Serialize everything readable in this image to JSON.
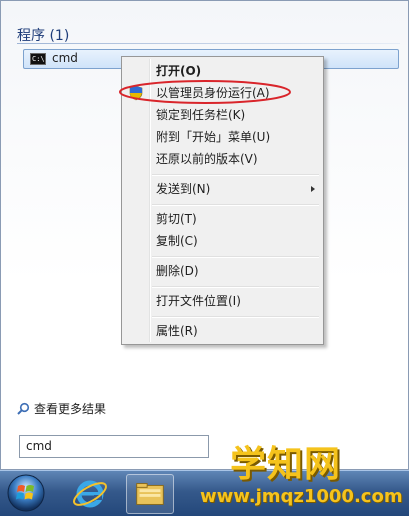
{
  "results": {
    "group_heading": "程序 (1)",
    "item_label": "cmd",
    "item_icon": "cmd-console-icon"
  },
  "context_menu": {
    "items": [
      {
        "label": "打开(O)",
        "bold": true
      },
      {
        "label": "以管理员身份运行(A)",
        "icon": "uac-shield-icon",
        "highlighted": true
      },
      {
        "label": "锁定到任务栏(K)"
      },
      {
        "label": "附到「开始」菜单(U)"
      },
      {
        "label": "还原以前的版本(V)"
      },
      {
        "label": "发送到(N)",
        "submenu": true
      },
      {
        "label": "剪切(T)"
      },
      {
        "label": "复制(C)"
      },
      {
        "label": "删除(D)"
      },
      {
        "label": "打开文件位置(I)"
      },
      {
        "label": "属性(R)"
      }
    ],
    "highlight_color": "#d9252b"
  },
  "see_more": {
    "label": "查看更多结果",
    "icon": "search-icon"
  },
  "search_box": {
    "value": "cmd"
  },
  "taskbar": {
    "items": [
      "start-orb-icon",
      "internet-explorer-icon",
      "windows-explorer-icon"
    ]
  },
  "watermark": {
    "title": "学知网",
    "url": "www.jmqz1000.com"
  }
}
